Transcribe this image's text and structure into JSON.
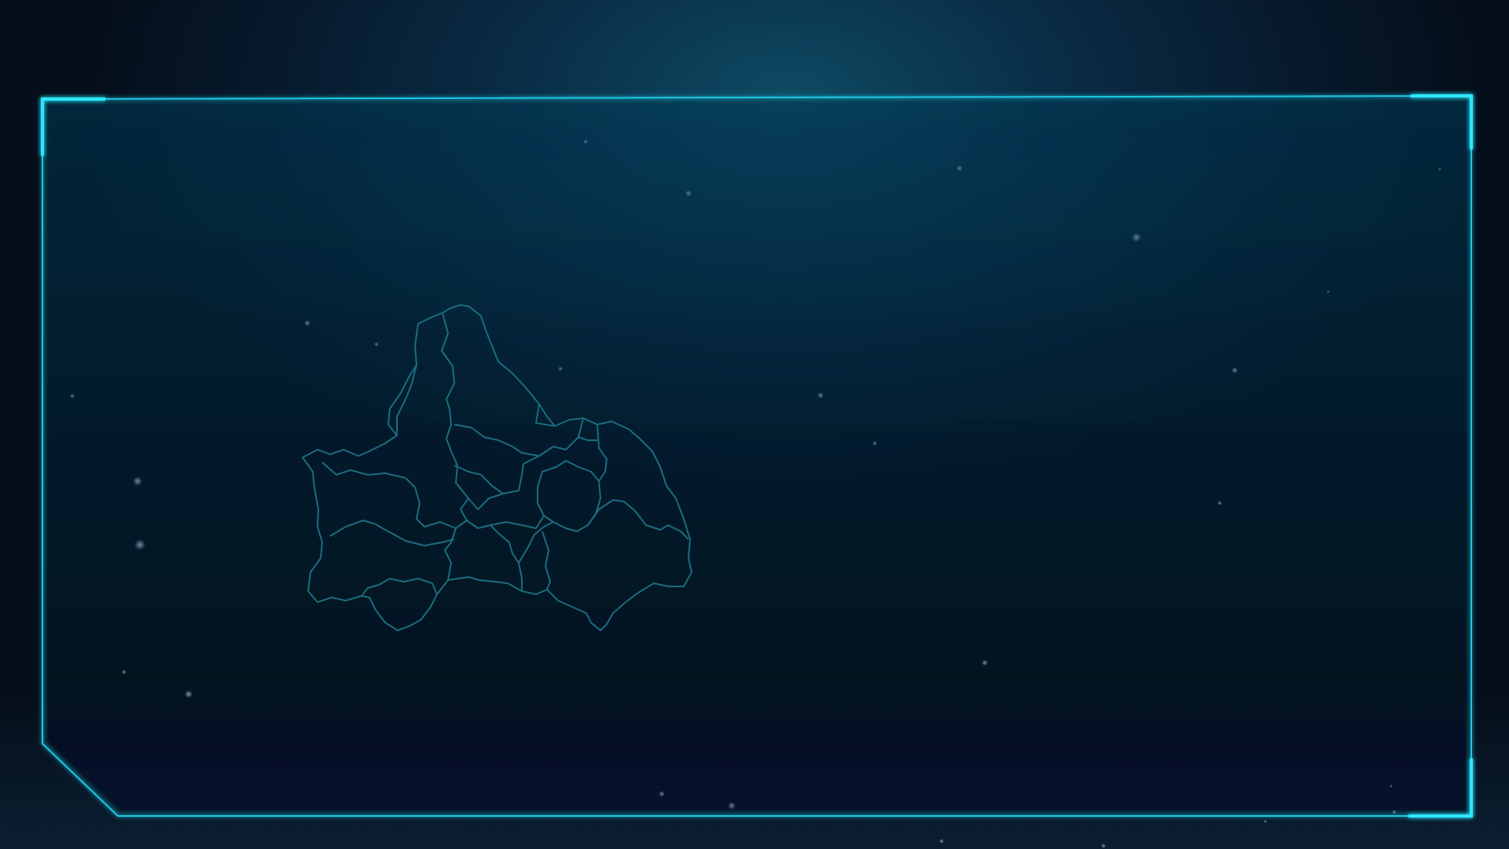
{
  "screen": {
    "background": "#07182a",
    "glow_color": "#0e4a63"
  },
  "panel": {
    "border_color": "#1ec8e6",
    "corner_accent_color": "#2ee6ff"
  },
  "map": {
    "stroke_color": "#1b6c80",
    "region_count": 18,
    "labels": []
  },
  "icons": [
    "star-particle"
  ]
}
